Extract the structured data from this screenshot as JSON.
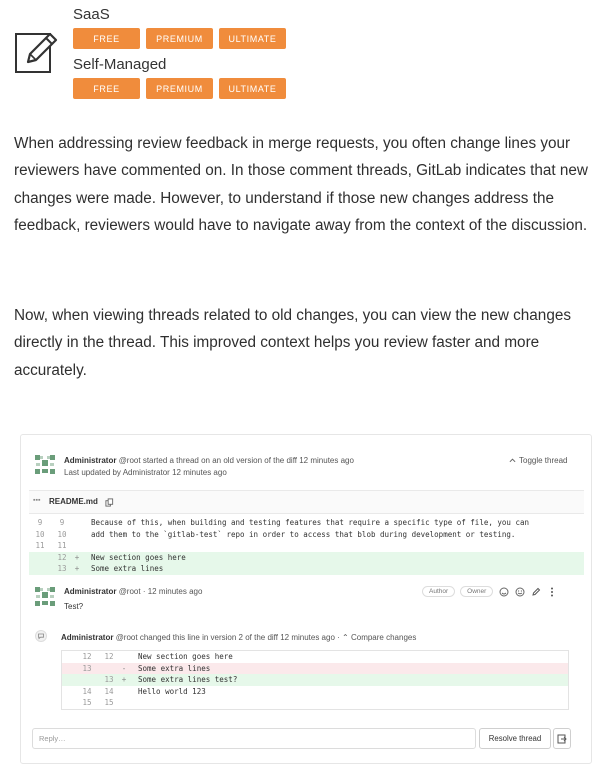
{
  "tiers": [
    {
      "name": "SaaS",
      "badges": [
        "FREE",
        "PREMIUM",
        "ULTIMATE"
      ]
    },
    {
      "name": "Self-Managed",
      "badges": [
        "FREE",
        "PREMIUM",
        "ULTIMATE"
      ]
    }
  ],
  "paragraphs": [
    "When addressing review feedback in merge requests, you often change lines your reviewers have commented on. In those comment threads, GitLab indicates that new changes were made. However, to understand if those new changes address the feedback, reviewers would have to navigate away from the context of the discussion.",
    "Now, when viewing threads related to old changes, you can view the new changes directly in the thread. This improved context helps you review faster and more accurately."
  ],
  "thread": {
    "author": "Administrator",
    "handle": "@root",
    "started_text": "started a thread on an old version of the diff 12 minutes ago",
    "updated_prefix": "Last updated by",
    "updated_author": "Administrator",
    "updated_time": "12 minutes ago",
    "toggle_label": "Toggle thread",
    "file_name": "README.md",
    "diff_rows": [
      {
        "old": "9",
        "new": "9",
        "mark": "",
        "type": "context",
        "text": "Because of this, when building and testing features that require a specific type of file, you can"
      },
      {
        "old": "10",
        "new": "10",
        "mark": "",
        "type": "context",
        "text": "add them to the `gitlab-test` repo in order to access that blob during development or testing."
      },
      {
        "old": "11",
        "new": "11",
        "mark": "",
        "type": "context",
        "text": ""
      },
      {
        "old": "",
        "new": "12",
        "mark": "+",
        "type": "added",
        "text": "New section goes here"
      },
      {
        "old": "",
        "new": "13",
        "mark": "+",
        "type": "added",
        "text": "Some extra lines"
      }
    ],
    "comment": {
      "author": "Administrator",
      "handle": "@root",
      "time": "· 12 minutes ago",
      "role_author": "Author",
      "role_owner": "Owner",
      "text": "Test?"
    },
    "system_note": {
      "author": "Administrator",
      "text": "@root changed this line in version 2 of the diff 12 minutes ago ·",
      "compare_label": "Compare changes"
    },
    "inner_diff_rows": [
      {
        "old": "12",
        "new": "12",
        "mark": "",
        "type": "context",
        "text": "New section goes here"
      },
      {
        "old": "13",
        "new": "",
        "mark": "-",
        "type": "removed",
        "text": "Some extra lines"
      },
      {
        "old": "",
        "new": "13",
        "mark": "+",
        "type": "added",
        "text": "Some extra lines test?"
      },
      {
        "old": "14",
        "new": "14",
        "mark": "",
        "type": "context",
        "text": "Hello world 123"
      },
      {
        "old": "15",
        "new": "15",
        "mark": "",
        "type": "context",
        "text": ""
      }
    ],
    "reply_placeholder": "Reply…",
    "resolve_label": "Resolve thread"
  },
  "colors": {
    "badge": "#f08c3c",
    "added": "#e6f8ea",
    "removed": "#fbe9eb"
  },
  "icons": [
    "edit-pencil-icon",
    "copy-icon",
    "chevron-up-icon",
    "smile-icon",
    "emoji-icon",
    "pencil-icon",
    "kebab-icon",
    "comment-icon",
    "resolve-icon"
  ]
}
